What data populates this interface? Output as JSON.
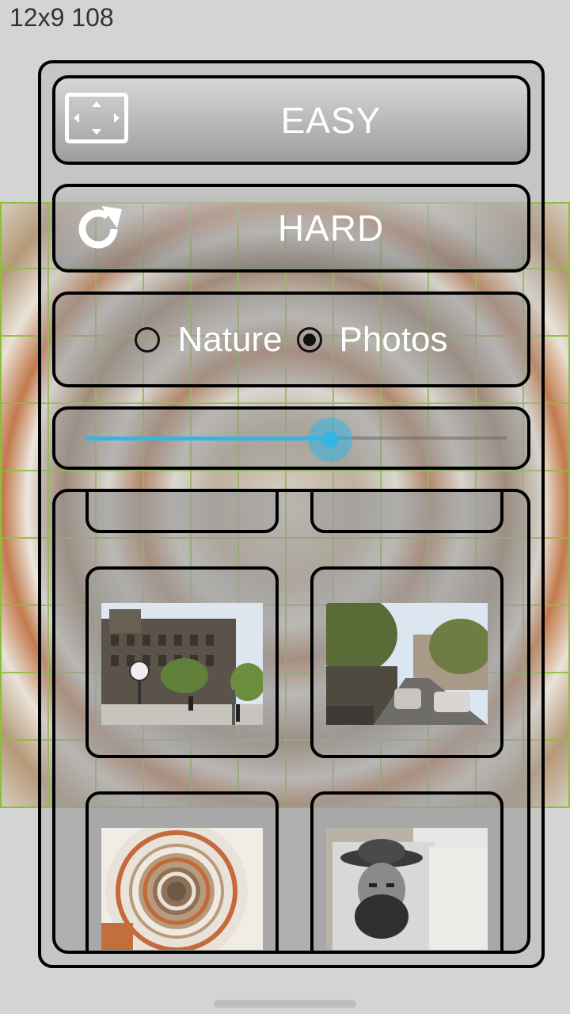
{
  "status": {
    "text": "12x9 108"
  },
  "buttons": {
    "easy": {
      "label": "EASY",
      "icon": "expand-icon"
    },
    "hard": {
      "label": "HARD",
      "icon": "refresh-icon"
    }
  },
  "category": {
    "options": [
      {
        "label": "Nature",
        "selected": false
      },
      {
        "label": "Photos",
        "selected": true
      }
    ]
  },
  "slider": {
    "value_fraction": 0.58,
    "accent": "#33b5e5"
  },
  "gallery": {
    "items": [
      {
        "name": "building-photo"
      },
      {
        "name": "street-photo"
      },
      {
        "name": "spiral-staircase-photo"
      },
      {
        "name": "portrait-drawing-photo"
      }
    ]
  }
}
